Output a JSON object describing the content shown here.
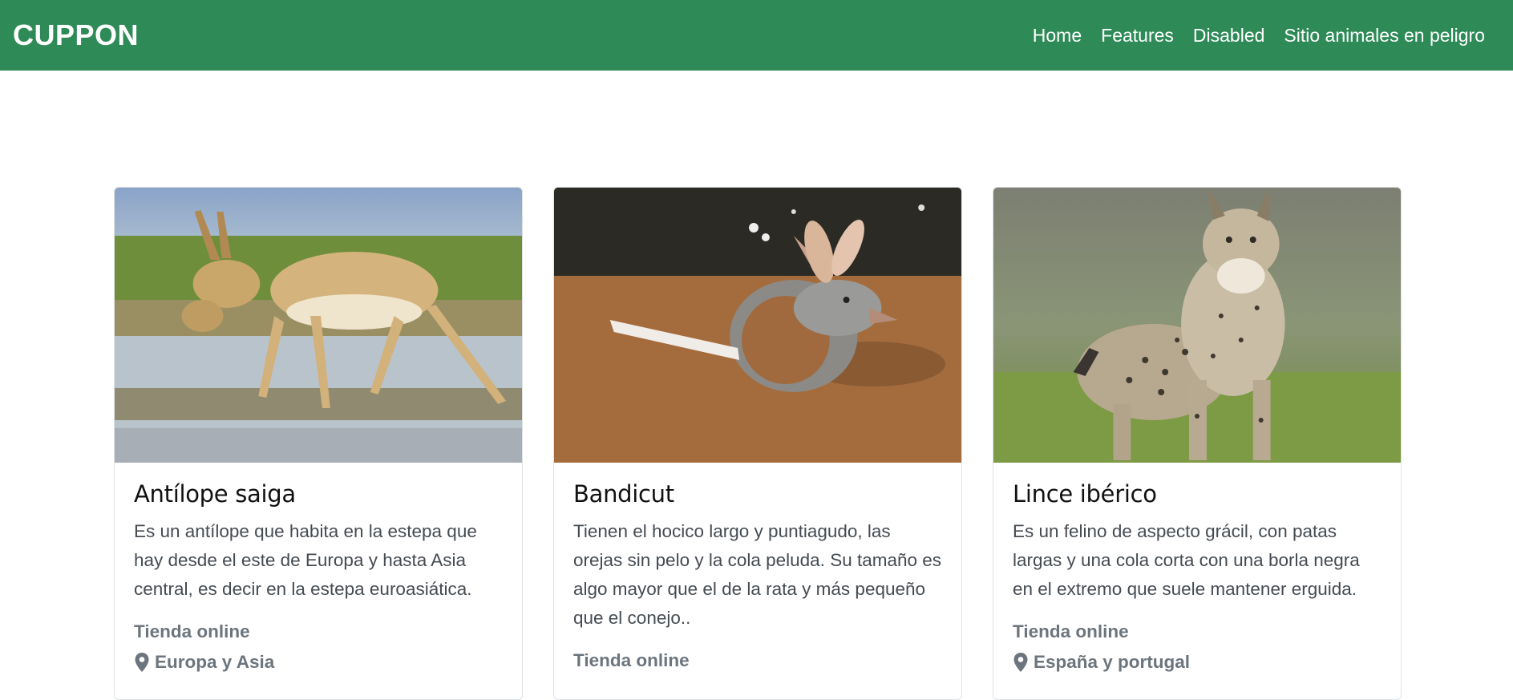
{
  "navbar": {
    "brand": "CUPPON",
    "links": [
      "Home",
      "Features",
      "Disabled",
      "Sitio animales en peligro"
    ],
    "bg": "#2e8b57"
  },
  "cards": [
    {
      "title": "Antílope saiga",
      "text": "Es un antílope que habita en la estepa que hay desde el este de Europa y hasta Asia central, es decir en la estepa euroasiática.",
      "store": "Tienda online",
      "location": "Europa y Asia",
      "image_icon": "saiga-antelope-photo"
    },
    {
      "title": "Bandicut",
      "text": "Tienen el hocico largo y puntiagudo, las orejas sin pelo y la cola peluda. Su tamaño es algo mayor que el de la rata y más pequeño que el conejo..",
      "store": "Tienda online",
      "location": "",
      "image_icon": "bandicoot-photo"
    },
    {
      "title": "Lince ibérico",
      "text": "Es un felino de aspecto grácil, con patas largas y una cola corta con una borla negra en el extremo que suele mantener erguida.",
      "store": "Tienda online",
      "location": "España y portugal",
      "image_icon": "iberian-lynx-photo"
    }
  ]
}
